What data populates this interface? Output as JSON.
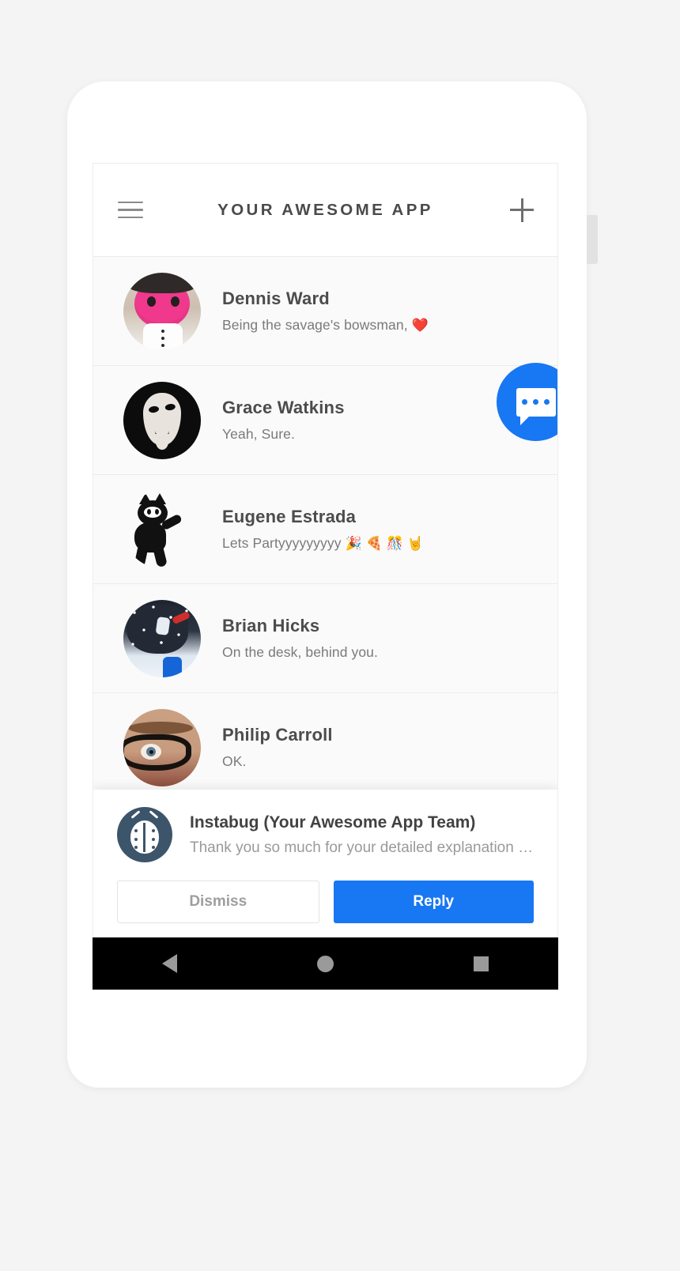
{
  "appbar": {
    "title": "YOUR AWESOME APP",
    "menu_icon": "hamburger-menu-icon",
    "add_icon": "plus-icon"
  },
  "fab": {
    "icon": "chat-bubble-icon",
    "color": "#1877f2"
  },
  "conversations": [
    {
      "name": "Dennis Ward",
      "message": "Being the savage's bowsman, ",
      "emoji": "❤️",
      "avatar": "pink-plush-toy-avatar"
    },
    {
      "name": "Grace Watkins",
      "message": "Yeah, Sure.",
      "emoji": "",
      "avatar": "guy-fawkes-mask-avatar"
    },
    {
      "name": "Eugene Estrada",
      "message": "Lets Partyyyyyyyyy ",
      "emoji": "🎉 🍕 🎊 🤘",
      "avatar": "felix-the-cat-avatar"
    },
    {
      "name": "Brian Hicks",
      "message": "On the desk, behind you.",
      "emoji": "",
      "avatar": "snowboarder-photo-avatar"
    },
    {
      "name": "Philip Carroll",
      "message": "OK.",
      "emoji": "",
      "avatar": "man-with-glasses-avatar"
    }
  ],
  "notification": {
    "logo": "instabug-ladybug-icon",
    "title": "Instabug (Your Awesome App Team)",
    "body": "Thank you so much for your detailed explanation o…",
    "dismiss_label": "Dismiss",
    "reply_label": "Reply",
    "reply_color": "#1877f2"
  },
  "navbar": {
    "back": "back-triangle-icon",
    "home": "home-circle-icon",
    "recents": "recents-square-icon"
  }
}
